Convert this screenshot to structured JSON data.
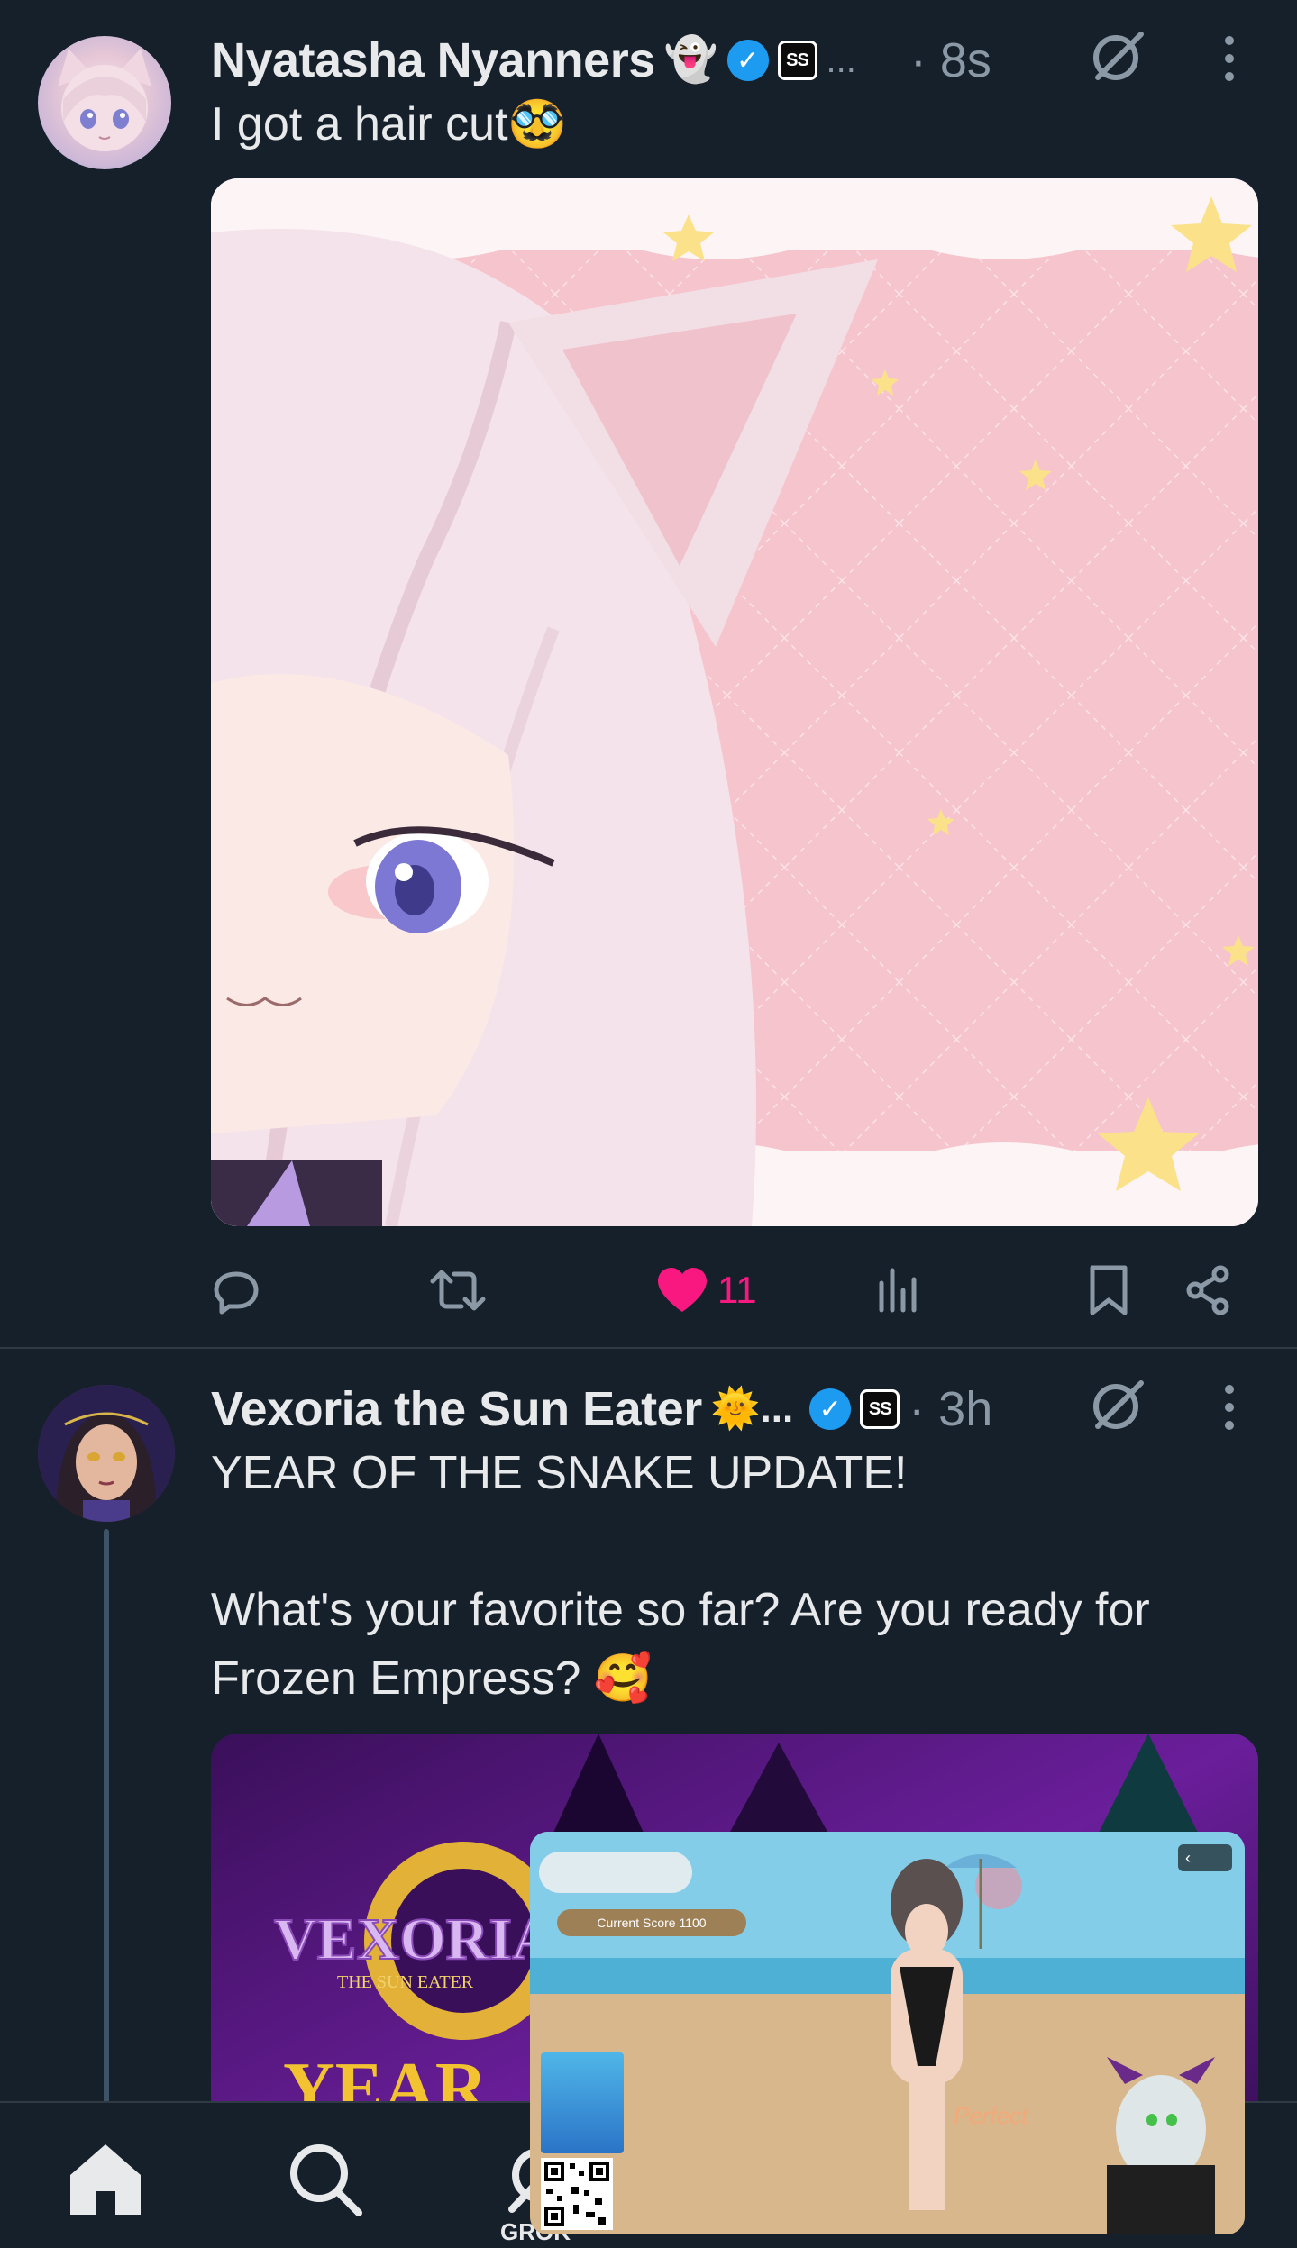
{
  "tweets": [
    {
      "display_name": "Nyatasha Nyanners",
      "name_emoji": "👻",
      "ellipsis": "...",
      "timestamp": "· 8s",
      "text": [
        "I got a hair cut🥸"
      ],
      "actions": {
        "likes": "11"
      }
    },
    {
      "display_name": "Vexoria the Sun Eater",
      "name_emoji": "🌞...",
      "timestamp": "· 3h",
      "text": [
        "YEAR OF THE SNAKE UPDATE!",
        "",
        "What's your favorite so far? Are you ready for Frozen Empress? 🥰"
      ],
      "media_texts": {
        "logo_title": "VEXORIA",
        "logo_subtitle": "THE SUN EATER",
        "banner_text": "YEAR"
      }
    }
  ],
  "pip_video": {
    "score_text": "Current Score 1100",
    "perfect_text": "Perfect"
  },
  "bottom_nav": {
    "grok_label": "GROK"
  },
  "colors": {
    "background": "#15202b",
    "text_primary": "#e7e9ea",
    "text_secondary": "#8b98a5",
    "verified": "#1d9bf0",
    "like": "#f91880"
  }
}
